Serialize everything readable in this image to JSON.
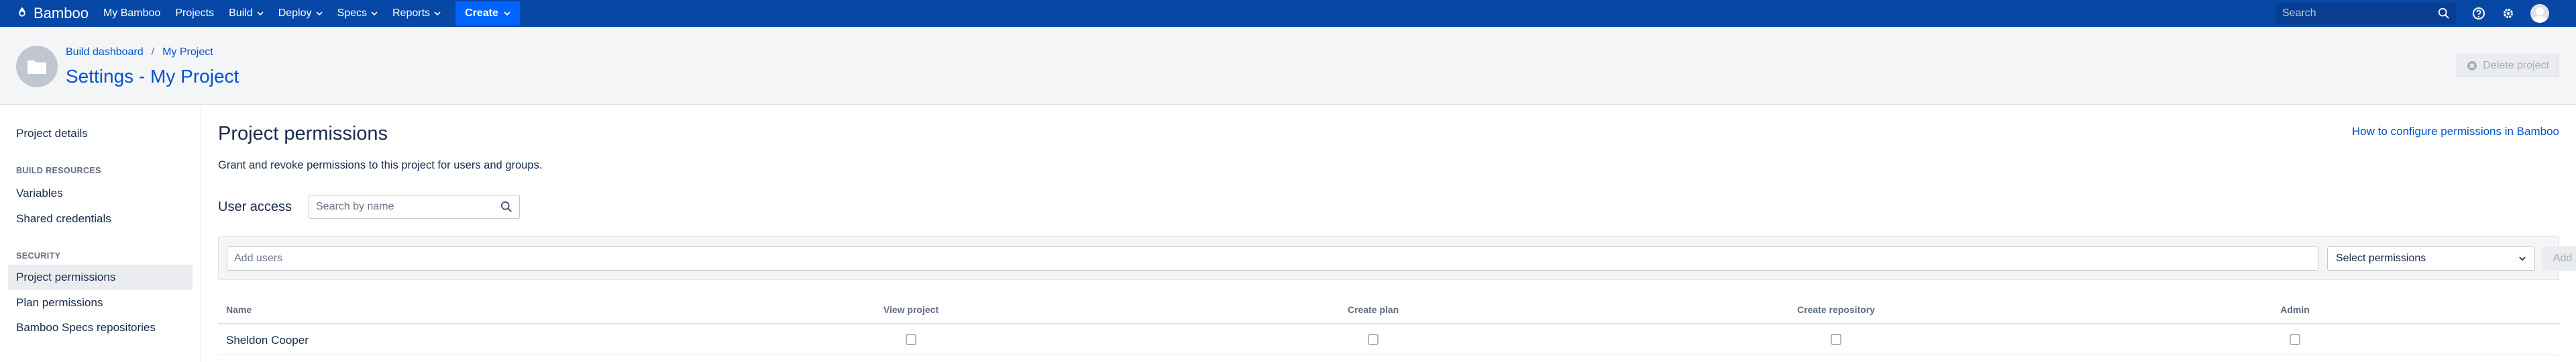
{
  "nav": {
    "logo_text": "Bamboo",
    "items": [
      {
        "label": "My Bamboo"
      },
      {
        "label": "Projects"
      },
      {
        "label": "Build",
        "dropdown": true
      },
      {
        "label": "Deploy",
        "dropdown": true
      },
      {
        "label": "Specs",
        "dropdown": true
      },
      {
        "label": "Reports",
        "dropdown": true
      }
    ],
    "create_label": "Create",
    "search_placeholder": "Search",
    "icons": [
      "help-icon",
      "gear-icon",
      "user-avatar"
    ],
    "colors": {
      "bar": "#0747a6",
      "create": "#0065ff"
    }
  },
  "header": {
    "breadcrumbs": [
      "Build dashboard",
      "My Project"
    ],
    "title": "Settings - My Project",
    "delete_label": "Delete project"
  },
  "sidebar": {
    "items": [
      {
        "label": "Project details"
      }
    ],
    "sections": [
      {
        "heading": "BUILD RESOURCES",
        "items": [
          {
            "label": "Variables"
          },
          {
            "label": "Shared credentials"
          }
        ]
      },
      {
        "heading": "SECURITY",
        "items": [
          {
            "label": "Project permissions",
            "active": true
          },
          {
            "label": "Plan permissions"
          },
          {
            "label": "Bamboo Specs repositories"
          }
        ]
      }
    ]
  },
  "main": {
    "title": "Project permissions",
    "help_link": "How to configure permissions in Bamboo",
    "description": "Grant and revoke permissions to this project for users and groups.",
    "user_access_label": "User access",
    "search_placeholder": "Search by name",
    "add_users_placeholder": "Add users",
    "select_permissions": "Select permissions",
    "add_label": "Add",
    "table": {
      "columns": [
        "Name",
        "View project",
        "Create plan",
        "Create repository",
        "Admin"
      ],
      "rows": [
        {
          "name": "Sheldon Cooper",
          "view_project": false,
          "create_plan": false,
          "create_repository": false,
          "admin": false
        }
      ]
    }
  }
}
